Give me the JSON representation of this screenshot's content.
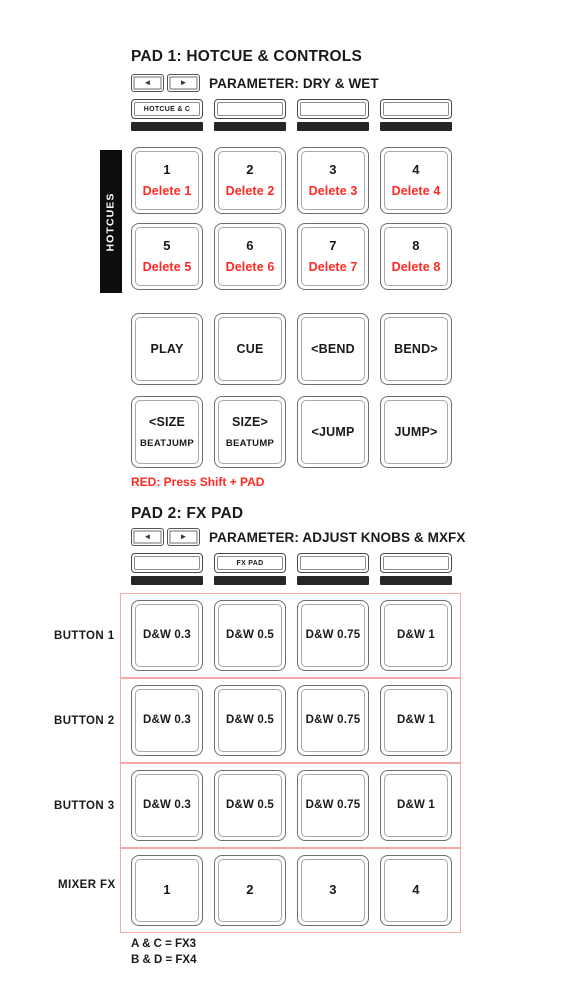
{
  "pad1": {
    "title": "PAD 1: HOTCUE & CONTROLS",
    "prev_arrow": "◄",
    "next_arrow": "►",
    "parameter": "PARAMETER: DRY & WET",
    "banks": [
      {
        "label": "HOTCUE & C"
      },
      {
        "label": ""
      },
      {
        "label": ""
      },
      {
        "label": ""
      }
    ],
    "side_tag": "HOTCUES",
    "hotcues": [
      {
        "num": "1",
        "shift": "Delete 1"
      },
      {
        "num": "2",
        "shift": "Delete 2"
      },
      {
        "num": "3",
        "shift": "Delete 3"
      },
      {
        "num": "4",
        "shift": "Delete 4"
      },
      {
        "num": "5",
        "shift": "Delete 5"
      },
      {
        "num": "6",
        "shift": "Delete 6"
      },
      {
        "num": "7",
        "shift": "Delete 7"
      },
      {
        "num": "8",
        "shift": "Delete 8"
      }
    ],
    "transport": [
      {
        "label": "PLAY",
        "sub": ""
      },
      {
        "label": "CUE",
        "sub": ""
      },
      {
        "label": "<BEND",
        "sub": ""
      },
      {
        "label": "BEND>",
        "sub": ""
      }
    ],
    "beatjump": [
      {
        "label": "<SIZE",
        "sub": "BEATJUMP"
      },
      {
        "label": "SIZE>",
        "sub": "BEATUMP"
      },
      {
        "label": "<JUMP",
        "sub": ""
      },
      {
        "label": "JUMP>",
        "sub": ""
      }
    ],
    "note": "RED: Press Shift + PAD"
  },
  "pad2": {
    "title": "PAD 2: FX PAD",
    "prev_arrow": "◄",
    "next_arrow": "►",
    "parameter": "PARAMETER: ADJUST KNOBS & MXFX",
    "banks": [
      {
        "label": ""
      },
      {
        "label": "FX PAD"
      },
      {
        "label": ""
      },
      {
        "label": ""
      }
    ],
    "rows": [
      {
        "name": "BUTTON 1",
        "pads": [
          "D&W 0.3",
          "D&W 0.5",
          "D&W 0.75",
          "D&W 1"
        ]
      },
      {
        "name": "BUTTON 2",
        "pads": [
          "D&W 0.3",
          "D&W 0.5",
          "D&W 0.75",
          "D&W 1"
        ]
      },
      {
        "name": "BUTTON 3",
        "pads": [
          "D&W 0.3",
          "D&W 0.5",
          "D&W 0.75",
          "D&W 1"
        ]
      },
      {
        "name": "MIXER FX",
        "pads": [
          "1",
          "2",
          "3",
          "4"
        ]
      }
    ],
    "note_line1": "A & C = FX3",
    "note_line2": "B & D = FX4"
  },
  "colors": {
    "red_text": "#ff2a23",
    "row_box_border": "#f7a8a8",
    "pad_border": "#6f6f6f",
    "bank_bar": "#262626",
    "tag_bg": "#0d0d0d"
  }
}
